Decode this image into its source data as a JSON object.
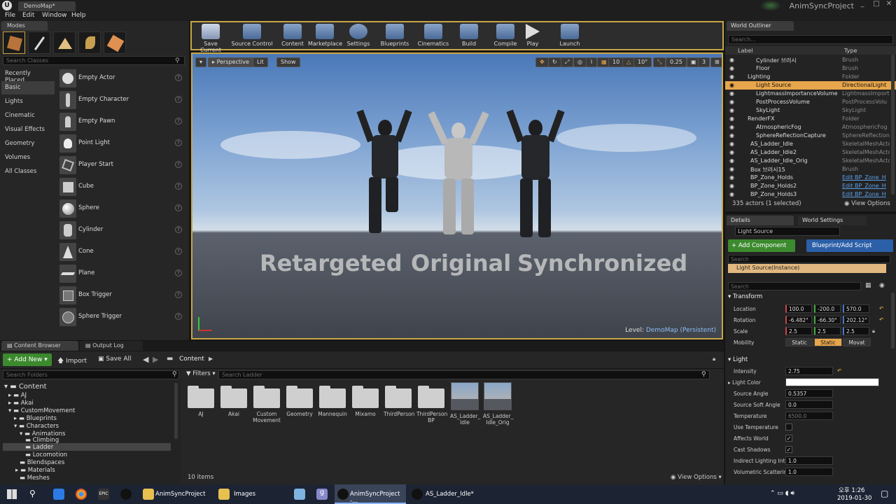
{
  "title_bar": {
    "tab_label": "DemoMap*",
    "project_name": "AnimSyncProject"
  },
  "menu": [
    "File",
    "Edit",
    "Window",
    "Help"
  ],
  "modes": {
    "tab_label": "Modes",
    "search_placeholder": "Search Classes",
    "categories": [
      "Recently Placed",
      "Basic",
      "Lights",
      "Cinematic",
      "Visual Effects",
      "Geometry",
      "Volumes",
      "All Classes"
    ],
    "active_category": "Basic",
    "actors": [
      "Empty Actor",
      "Empty Character",
      "Empty Pawn",
      "Point Light",
      "Player Start",
      "Cube",
      "Sphere",
      "Cylinder",
      "Cone",
      "Plane",
      "Box Trigger",
      "Sphere Trigger"
    ]
  },
  "toolbar": {
    "buttons": [
      "Save Current",
      "Source Control",
      "Content",
      "Marketplace",
      "Settings",
      "Blueprints",
      "Cinematics",
      "Build",
      "Compile",
      "Play",
      "Launch"
    ]
  },
  "viewport": {
    "perspective": "Perspective",
    "lit": "Lit",
    "show": "Show",
    "grid_snap": "10",
    "rot_snap": "10°",
    "scale_snap": "0.25",
    "camera_speed": "3",
    "labels": [
      "Retargeted",
      "Original",
      "Synchronized"
    ],
    "level_label": "Level:",
    "level_name": "DemoMap (Persistent)"
  },
  "outliner": {
    "tab_label": "World Outliner",
    "search_placeholder": "Search...",
    "col_label": "Label",
    "col_type": "Type",
    "rows": [
      {
        "label": "Cylinder 브러시",
        "type": "Brush"
      },
      {
        "label": "Floor",
        "type": "Brush"
      },
      {
        "label": "Lighting",
        "type": "Folder"
      },
      {
        "label": "Light Source",
        "type": "DirectionalLight"
      },
      {
        "label": "LightmassImportanceVolume",
        "type": "LightmassImport"
      },
      {
        "label": "PostProcessVolume",
        "type": "PostProcessVolu"
      },
      {
        "label": "SkyLight",
        "type": "SkyLight"
      },
      {
        "label": "RenderFX",
        "type": "Folder"
      },
      {
        "label": "AtmosphericFog",
        "type": "AtmosphericFog"
      },
      {
        "label": "SphereReflectionCapture",
        "type": "SphereReflection"
      },
      {
        "label": "AS_Ladder_Idle",
        "type": "SkeletalMeshActo"
      },
      {
        "label": "AS_Ladder_Idle2",
        "type": "SkeletalMeshActo"
      },
      {
        "label": "AS_Ladder_Idle_Orig",
        "type": "SkeletalMeshActo"
      },
      {
        "label": "Box 브러시15",
        "type": "Brush"
      },
      {
        "label": "BP_Zone_Holds",
        "type": "Edit BP_Zone_H"
      },
      {
        "label": "BP_Zone_Holds2",
        "type": "Edit BP_Zone_H"
      },
      {
        "label": "BP_Zone_Holds3",
        "type": "Edit BP_Zone_H"
      }
    ],
    "count": "335 actors (1 selected)",
    "view_options": "View Options"
  },
  "details": {
    "tab_details": "Details",
    "tab_world": "World Settings",
    "name": "Light Source",
    "add_component": "+ Add Component",
    "blueprint_script": "Blueprint/Add Script",
    "search_placeholder": "Search",
    "instance": "Light Source(Instance)",
    "section_transform": "Transform",
    "location_label": "Location",
    "location": [
      "100.0",
      "-200.0",
      "570.0"
    ],
    "rotation_label": "Rotation",
    "rotation": [
      "-6.482°",
      "-66.30°",
      "202.12°"
    ],
    "scale_label": "Scale",
    "scale": [
      "2.5",
      "2.5",
      "2.5"
    ],
    "mobility_label": "Mobility",
    "mobility": [
      "Static",
      "Static",
      "Movat"
    ],
    "section_light": "Light",
    "intensity_label": "Intensity",
    "intensity": "2.75",
    "light_color_label": "Light Color",
    "source_angle_label": "Source Angle",
    "source_angle": "0.5357",
    "soft_angle_label": "Source Soft Angle",
    "soft_angle": "0.0",
    "temperature_label": "Temperature",
    "temperature": "6500.0",
    "use_temp_label": "Use Temperature",
    "affects_world_label": "Affects World",
    "cast_shadows_label": "Cast Shadows",
    "indirect_label": "Indirect Lighting Inte",
    "indirect": "1.0",
    "volumetric_label": "Volumetric Scatterin",
    "volumetric": "1.0"
  },
  "content_browser": {
    "tab_cb": "Content Browser",
    "tab_log": "Output Log",
    "add_new": "Add New",
    "import": "Import",
    "save_all": "Save All",
    "path": "Content",
    "search_folders": "Search Folders",
    "filters": "Filters",
    "search_assets": "Search Ladder",
    "tree": [
      "Content",
      "AJ",
      "Akai",
      "CustomMovement",
      "Blueprints",
      "Characters",
      "Animations",
      "Climbing",
      "Ladder",
      "Locomotion",
      "Blendspaces",
      "Materials",
      "Meshes"
    ],
    "assets": [
      "AJ",
      "Akai",
      "Custom Movement",
      "Geometry",
      "Mannequin",
      "Mixamo",
      "ThirdPerson",
      "ThirdPerson BP",
      "AS_Ladder_ Idle",
      "AS_Ladder_ Idle_Orig"
    ],
    "item_count": "10 items",
    "view_options": "View Options"
  },
  "taskbar": {
    "apps": [
      "AnimSyncProject",
      "Images",
      "AnimSyncProject -...",
      "AS_Ladder_Idle*"
    ],
    "time": "오후 1:26",
    "date": "2019-01-30"
  }
}
